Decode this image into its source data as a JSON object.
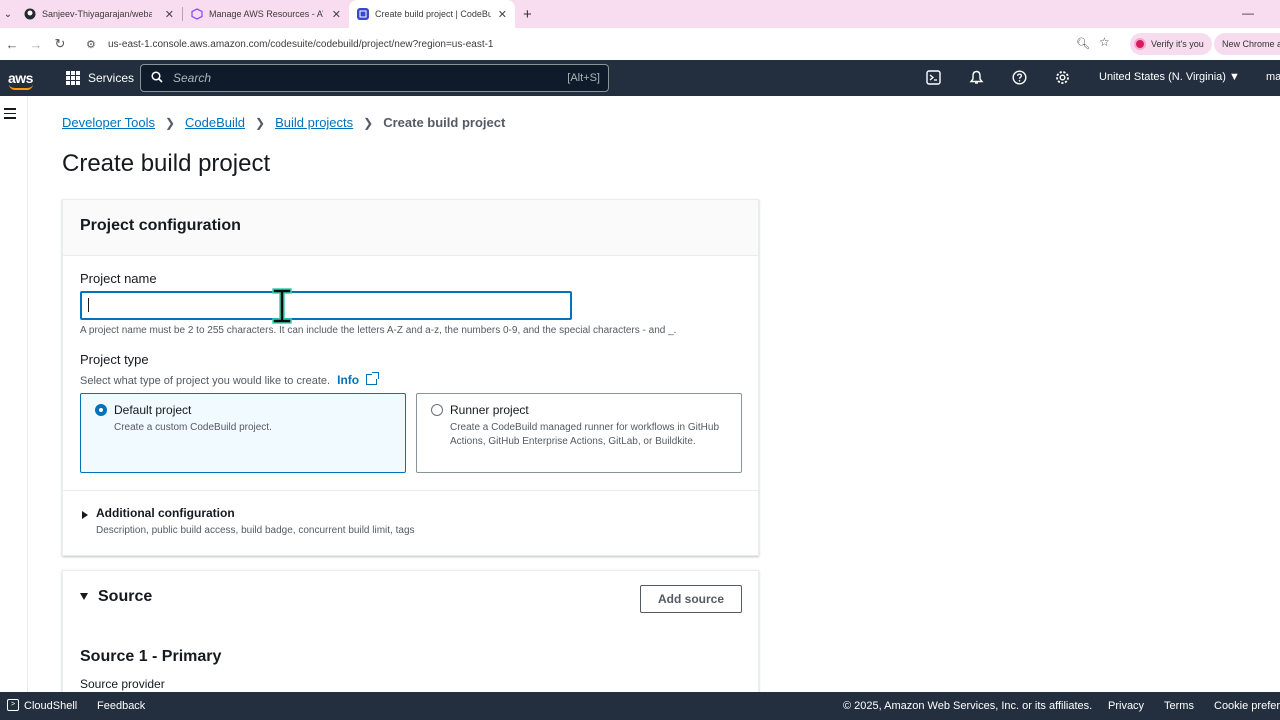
{
  "browser": {
    "tabs": [
      {
        "title": "Sanjeev-Thiyagarajan/webapp",
        "active": false
      },
      {
        "title": "Manage AWS Resources - AWS",
        "active": false
      },
      {
        "title": "Create build project | CodeBuild",
        "active": true
      }
    ],
    "url": "us-east-1.console.aws.amazon.com/codesuite/codebuild/project/new?region=us-east-1",
    "verify_label": "Verify it's you",
    "new_chrome_label": "New Chrome av"
  },
  "aws_nav": {
    "logo": "aws",
    "services_label": "Services",
    "search_placeholder": "Search",
    "search_shortcut": "[Alt+S]",
    "region": "United States (N. Virginia) ▼",
    "user": "ma"
  },
  "breadcrumb": {
    "items": [
      "Developer Tools",
      "CodeBuild",
      "Build projects"
    ],
    "current": "Create build project"
  },
  "page_title": "Create build project",
  "project_config": {
    "title": "Project configuration",
    "name_label": "Project name",
    "name_value": "",
    "name_hint": "A project name must be 2 to 255 characters. It can include the letters A-Z and a-z, the numbers 0-9, and the special characters - and _.",
    "type_label": "Project type",
    "type_hint": "Select what type of project you would like to create.",
    "info_label": "Info",
    "options": [
      {
        "title": "Default project",
        "desc": "Create a custom CodeBuild project.",
        "selected": true
      },
      {
        "title": "Runner project",
        "desc": "Create a CodeBuild managed runner for workflows in GitHub Actions, GitHub Enterprise Actions, GitLab, or Buildkite.",
        "selected": false
      }
    ],
    "additional_title": "Additional configuration",
    "additional_desc": "Description, public build access, build badge, concurrent build limit, tags"
  },
  "source": {
    "title": "Source",
    "add_source_label": "Add source",
    "primary_title": "Source 1 - Primary",
    "provider_label": "Source provider"
  },
  "footer": {
    "cloudshell": "CloudShell",
    "feedback": "Feedback",
    "copyright": "© 2025, Amazon Web Services, Inc. or its affiliates.",
    "privacy": "Privacy",
    "terms": "Terms",
    "cookie": "Cookie prefere"
  },
  "colors": {
    "nav_bg": "#232f3e",
    "link": "#0073bb",
    "tabstrip_bg": "#f8dcef",
    "accent_orange": "#ff9900"
  }
}
